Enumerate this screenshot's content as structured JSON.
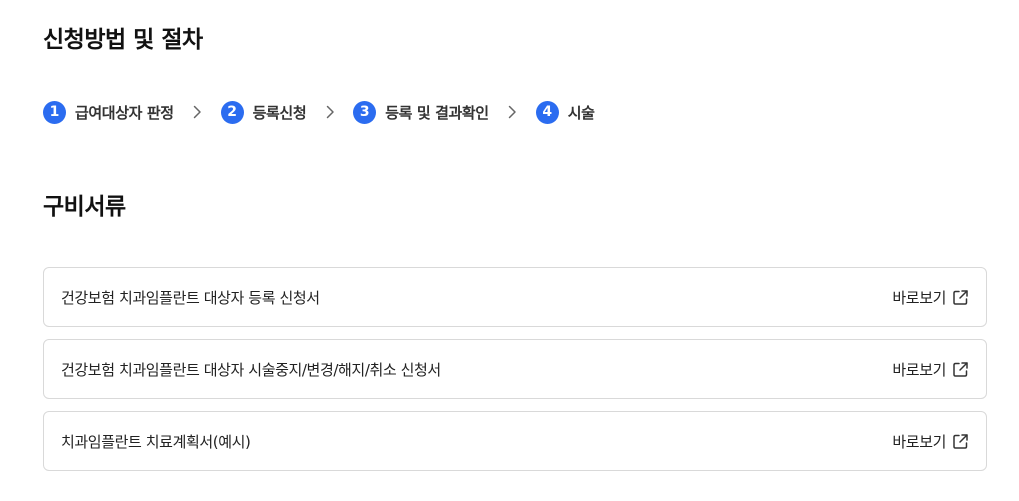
{
  "procedure": {
    "title": "신청방법 및 절차",
    "steps": [
      {
        "number": "1",
        "label": "급여대상자 판정"
      },
      {
        "number": "2",
        "label": "등록신청"
      },
      {
        "number": "3",
        "label": "등록 및 결과확인"
      },
      {
        "number": "4",
        "label": "시술"
      }
    ],
    "step_separator_icon": "chevron-right-icon"
  },
  "documents": {
    "title": "구비서류",
    "items": [
      {
        "name": "건강보험 치과임플란트 대상자 등록 신청서",
        "link_label": "바로보기",
        "link_icon": "external-link-icon"
      },
      {
        "name": "건강보험 치과임플란트 대상자 시술중지/변경/해지/취소 신청서",
        "link_label": "바로보기",
        "link_icon": "external-link-icon"
      },
      {
        "name": "치과임플란트 치료계획서(예시)",
        "link_label": "바로보기",
        "link_icon": "external-link-icon"
      }
    ]
  },
  "colors": {
    "step_badge": "#2b6cf0",
    "card_border": "#d9d9d9",
    "text": "#222222"
  }
}
